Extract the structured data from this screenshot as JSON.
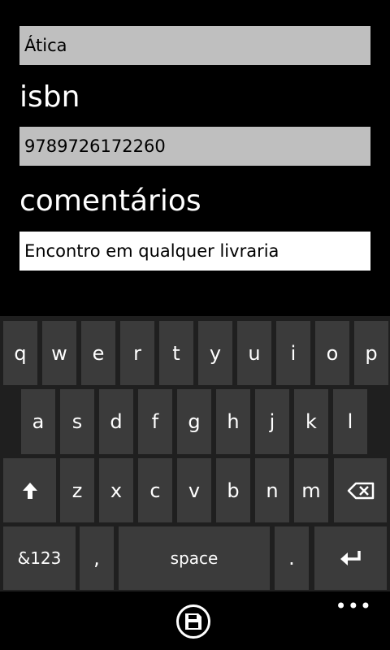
{
  "form": {
    "publisher_value": "Ática",
    "isbn_label": "isbn",
    "isbn_value": "9789726172260",
    "comments_label": "comentários",
    "comments_value": "Encontro em qualquer livraria"
  },
  "keyboard": {
    "row1": [
      "q",
      "w",
      "e",
      "r",
      "t",
      "y",
      "u",
      "i",
      "o",
      "p"
    ],
    "row2": [
      "a",
      "s",
      "d",
      "f",
      "g",
      "h",
      "j",
      "k",
      "l"
    ],
    "row3": [
      "z",
      "x",
      "c",
      "v",
      "b",
      "n",
      "m"
    ],
    "symbols_label": "&123",
    "comma_label": ",",
    "space_label": "space",
    "period_label": ".",
    "shift_icon": "shift-up-arrow",
    "backspace_icon": "backspace",
    "enter_icon": "enter-arrow"
  },
  "appbar": {
    "save_icon": "save-disk",
    "more_label": "•••"
  },
  "colors": {
    "background": "#000000",
    "field_inactive": "#bfbfbf",
    "field_active": "#ffffff",
    "keyboard_bg": "#1f1f1f",
    "key_bg": "#3b3b3b"
  }
}
